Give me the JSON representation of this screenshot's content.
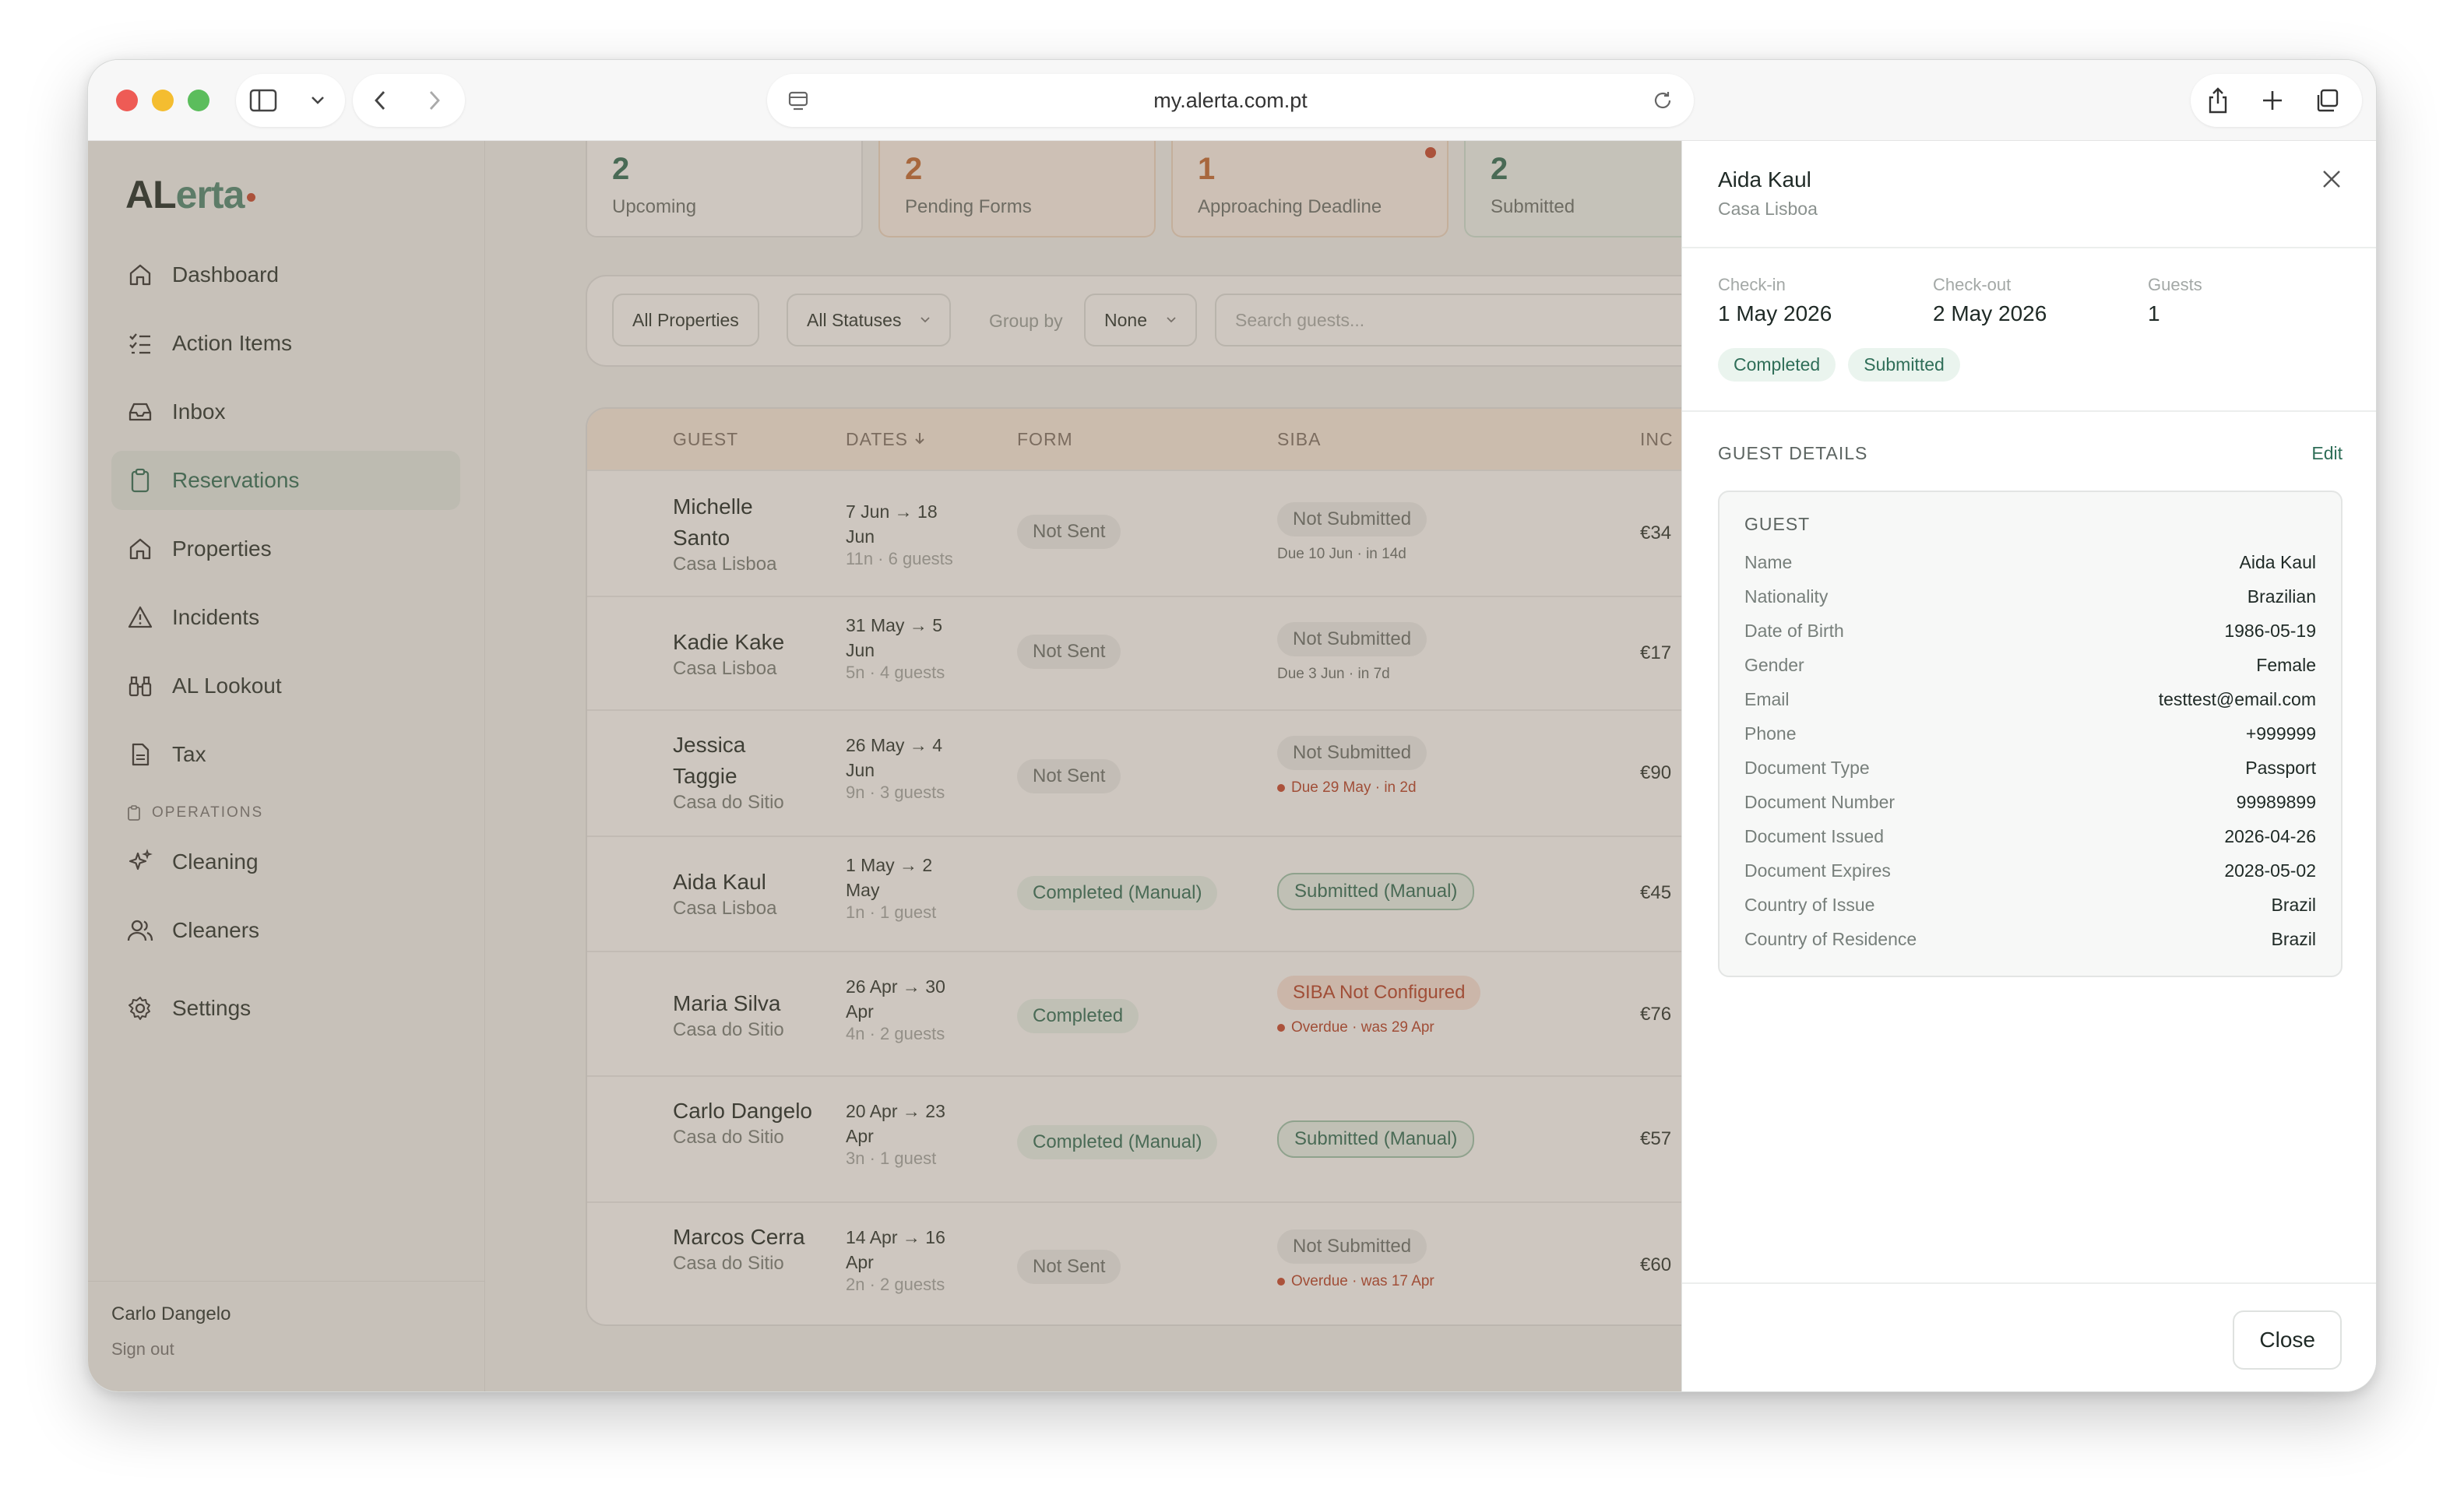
{
  "browser": {
    "url": "my.alerta.com.pt"
  },
  "app": {
    "logo_main": "AL",
    "logo_accent": "erta"
  },
  "sidebar": {
    "items": [
      {
        "label": "Dashboard",
        "icon": "home-icon"
      },
      {
        "label": "Action Items",
        "icon": "checklist-icon"
      },
      {
        "label": "Inbox",
        "icon": "inbox-icon"
      },
      {
        "label": "Reservations",
        "icon": "clipboard-icon",
        "active": true
      },
      {
        "label": "Properties",
        "icon": "home-icon"
      },
      {
        "label": "Incidents",
        "icon": "warning-icon"
      },
      {
        "label": "AL Lookout",
        "icon": "binoculars-icon"
      },
      {
        "label": "Tax",
        "icon": "document-icon"
      }
    ],
    "section_operations": "OPERATIONS",
    "ops_items": [
      {
        "label": "Cleaning",
        "icon": "sparkle-icon"
      },
      {
        "label": "Cleaners",
        "icon": "users-icon"
      }
    ],
    "settings": {
      "label": "Settings",
      "icon": "gear-icon"
    },
    "user_name": "Carlo Dangelo",
    "sign_out": "Sign out"
  },
  "stats": [
    {
      "value": "2",
      "label": "Upcoming"
    },
    {
      "value": "2",
      "label": "Pending Forms"
    },
    {
      "value": "1",
      "label": "Approaching Deadline"
    },
    {
      "value": "2",
      "label": "Submitted"
    }
  ],
  "filters": {
    "properties": "All Properties",
    "statuses": "All Statuses",
    "group_by_label": "Group by",
    "group_by_value": "None",
    "search_placeholder": "Search guests..."
  },
  "table": {
    "headers": [
      "GUEST",
      "DATES",
      "FORM",
      "SIBA",
      "INC"
    ],
    "rows": [
      {
        "name": "Michelle Santo",
        "property": "Casa Lisboa",
        "dates": "7 Jun → 18 Jun",
        "nights": "11n · 6 guests",
        "form": "Not Sent",
        "siba": "Not Submitted",
        "due": "Due 10 Jun · in 14d",
        "inc": "€34"
      },
      {
        "name": "Kadie Kake",
        "property": "Casa Lisboa",
        "dates": "31 May → 5 Jun",
        "nights": "5n · 4 guests",
        "form": "Not Sent",
        "siba": "Not Submitted",
        "due": "Due 3 Jun · in 7d",
        "inc": "€17"
      },
      {
        "name": "Jessica Taggie",
        "property": "Casa do Sitio",
        "dates": "26 May → 4 Jun",
        "nights": "9n · 3 guests",
        "form": "Not Sent",
        "siba": "Not Submitted",
        "due": "Due 29 May · in 2d",
        "inc": "€90"
      },
      {
        "name": "Aida Kaul",
        "property": "Casa Lisboa",
        "dates": "1 May → 2 May",
        "nights": "1n · 1 guest",
        "form": "Completed (Manual)",
        "siba": "Submitted (Manual)",
        "due": "",
        "inc": "€45"
      },
      {
        "name": "Maria Silva",
        "property": "Casa do Sitio",
        "dates": "26 Apr → 30 Apr",
        "nights": "4n · 2 guests",
        "form": "Completed",
        "siba": "SIBA Not Configured",
        "due": "Overdue · was 29 Apr",
        "inc": "€76"
      },
      {
        "name": "Carlo Dangelo",
        "property": "Casa do Sitio",
        "dates": "20 Apr → 23 Apr",
        "nights": "3n · 1 guest",
        "form": "Completed (Manual)",
        "siba": "Submitted (Manual)",
        "due": "",
        "inc": "€57"
      },
      {
        "name": "Marcos Cerra",
        "property": "Casa do Sitio",
        "dates": "14 Apr → 16 Apr",
        "nights": "2n · 2 guests",
        "form": "Not Sent",
        "siba": "Not Submitted",
        "due": "Overdue · was 17 Apr",
        "inc": "€60"
      }
    ]
  },
  "drawer": {
    "guest_name": "Aida Kaul",
    "property": "Casa Lisboa",
    "checkin_label": "Check-in",
    "checkin_value": "1 May 2026",
    "checkout_label": "Check-out",
    "checkout_value": "2 May 2026",
    "guests_label": "Guests",
    "guests_value": "1",
    "badge_form": "Completed",
    "badge_siba": "Submitted",
    "section_title": "GUEST DETAILS",
    "edit_label": "Edit",
    "card_title": "GUEST",
    "details": [
      {
        "k": "Name",
        "v": "Aida Kaul"
      },
      {
        "k": "Nationality",
        "v": "Brazilian"
      },
      {
        "k": "Date of Birth",
        "v": "1986-05-19"
      },
      {
        "k": "Gender",
        "v": "Female"
      },
      {
        "k": "Email",
        "v": "testtest@email.com"
      },
      {
        "k": "Phone",
        "v": "+999999"
      },
      {
        "k": "Document Type",
        "v": "Passport"
      },
      {
        "k": "Document Number",
        "v": "99989899"
      },
      {
        "k": "Document Issued",
        "v": "2026-04-26"
      },
      {
        "k": "Document Expires",
        "v": "2028-05-02"
      },
      {
        "k": "Country of Issue",
        "v": "Brazil"
      },
      {
        "k": "Country of Residence",
        "v": "Brazil"
      }
    ],
    "close_label": "Close"
  }
}
